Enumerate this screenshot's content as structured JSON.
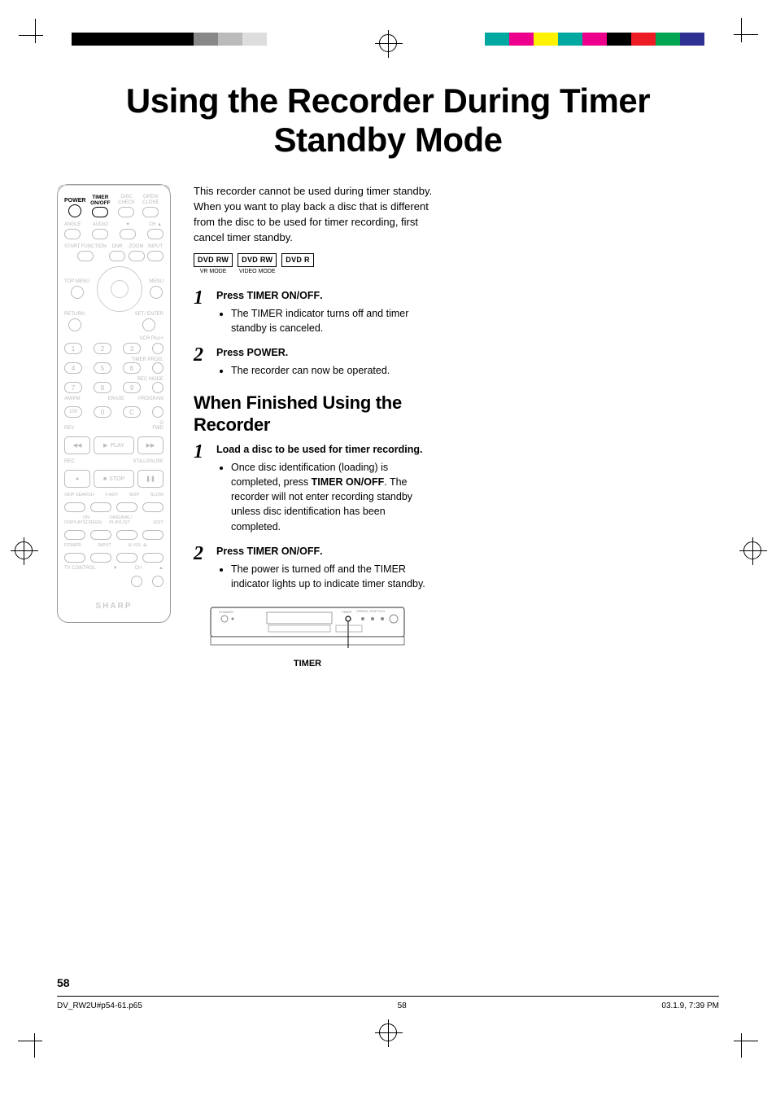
{
  "title": "Using the Recorder During Timer Standby Mode",
  "intro": "This recorder cannot be used during timer standby. When you want to play back a disc that is different from the disc to be used for timer recording, first cancel timer standby.",
  "disc_tags": [
    {
      "label": "DVD RW",
      "sub": "VR MODE"
    },
    {
      "label": "DVD RW",
      "sub": "VIDEO MODE"
    },
    {
      "label": "DVD R",
      "sub": ""
    }
  ],
  "steps_a": [
    {
      "num": "1",
      "inst_pre": "Press ",
      "inst_bold": "TIMER ON/OFF",
      "inst_post": ".",
      "bullets": [
        "The TIMER indicator turns off and timer standby is canceled."
      ]
    },
    {
      "num": "2",
      "inst_pre": "Press ",
      "inst_bold": "POWER",
      "inst_post": ".",
      "bullets": [
        "The recorder can now be operated."
      ]
    }
  ],
  "section_b_title": "When Finished Using the Recorder",
  "steps_b": [
    {
      "num": "1",
      "inst_pre": "",
      "inst_bold": "Load a disc to be used for timer recording.",
      "inst_post": "",
      "bullets_rich": [
        {
          "pre": "Once disc identification (loading) is completed, press ",
          "bold": "TIMER ON/OFF",
          "post": ". The recorder will not enter recording standby unless disc identification has been completed."
        }
      ]
    },
    {
      "num": "2",
      "inst_pre": "Press ",
      "inst_bold": "TIMER ON/OFF",
      "inst_post": ".",
      "bullets": [
        "The power is turned off and the TIMER indicator lights up to indicate timer standby."
      ]
    }
  ],
  "panel_label": "TIMER",
  "remote": {
    "power": "POWER",
    "timer": "TIMER ON/OFF",
    "disc_check": "DISC CHECK",
    "open_close": "OPEN/ CLOSE",
    "angle": "ANGLE",
    "audio": "AUDIO",
    "ch": "CH",
    "start_function": "START FUNCTION",
    "dnr": "DNR",
    "zoom": "ZOOM",
    "input": "INPUT",
    "top_menu": "TOP MENU",
    "menu": "MENU",
    "return": "RETURN",
    "set_enter": "SET/ ENTER",
    "vcr_plus": "VCR Plus+",
    "timer_prog": "TIMER PROG.",
    "rec_mode": "REC MODE",
    "am_pm": "AM/PM",
    "erase": "ERASE",
    "program": "PROGRAM",
    "g": "G",
    "rev": "REV",
    "fwd": "FWD",
    "play": "PLAY",
    "rec": "REC",
    "stop": "STOP",
    "still_pause": "STILL/PAUSE",
    "skip_search": "SKIP SEARCH",
    "fadv": "F.ADV",
    "skip": "SKIP",
    "slow": "SLOW",
    "display": "DISPLAY",
    "on_screen": "ON SCREEN",
    "original_playlist": "ORIGINAL/ PLAYLIST",
    "edit": "EDIT",
    "tv_power": "POWER",
    "tv_input": "INPUT",
    "vol": "VOL",
    "tv_control": "TV CONTROL",
    "brand": "SHARP"
  },
  "color_bars_left": [
    "#000",
    "#000",
    "#000",
    "#000",
    "#000",
    "#888",
    "#bbb",
    "#ddd"
  ],
  "color_bars_right": [
    "#00a9a0",
    "#ec008c",
    "#fff200",
    "#00a9a0",
    "#ec008c",
    "#000",
    "#ed1c24",
    "#00a651",
    "#2e3192"
  ],
  "page_number": "58",
  "footer_file": "DV_RW2U#p54-61.p65",
  "footer_page": "58",
  "footer_date": "03.1.9, 7:39 PM"
}
